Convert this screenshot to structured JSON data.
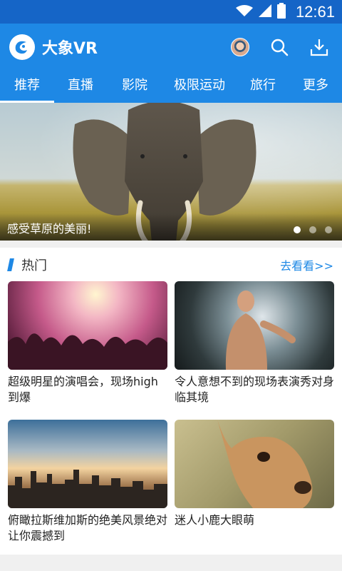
{
  "status_bar": {
    "time": "12:61",
    "icons": [
      "wifi-icon",
      "signal-icon",
      "battery-icon"
    ]
  },
  "app_bar": {
    "title": "大象VR",
    "actions": [
      "avatar",
      "search-icon",
      "download-icon"
    ],
    "colors": {
      "primary": "#1e88e5",
      "status": "#1565c7"
    }
  },
  "tabs": [
    {
      "label": "推荐",
      "active": true
    },
    {
      "label": "直播",
      "active": false
    },
    {
      "label": "影院",
      "active": false
    },
    {
      "label": "极限运动",
      "active": false
    },
    {
      "label": "旅行",
      "active": false
    },
    {
      "label": "更多",
      "active": false
    }
  ],
  "banner": {
    "caption": "感受草原的美丽!",
    "dots": 3,
    "active_dot": 0
  },
  "section": {
    "title": "热门",
    "more": "去看看>>",
    "cards": [
      {
        "title": "超级明星的演唱会，现场high到爆",
        "image": "concert-image"
      },
      {
        "title": "令人意想不到的现场表演秀对身临其境",
        "image": "performer-image"
      },
      {
        "title": "俯瞰拉斯维加斯的绝美风景绝对让你震撼到",
        "image": "city-skyline-image"
      },
      {
        "title": "迷人小鹿大眼萌",
        "image": "deer-image"
      }
    ]
  }
}
